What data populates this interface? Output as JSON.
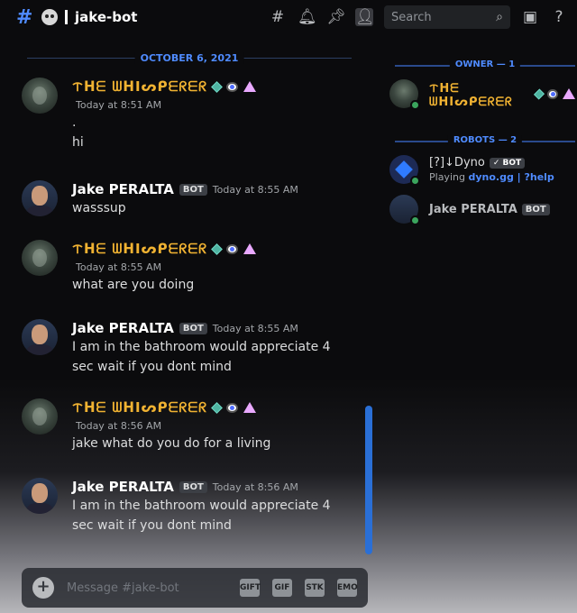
{
  "header": {
    "channel_name": "jake-bot",
    "search_placeholder": "Search"
  },
  "date_separator": "OCTOBER 6, 2021",
  "messages": [
    {
      "author": "ᝨᕼᗴ ᗯᕼIᔕᑭᗴᖇᗴᖇ",
      "timestamp": "Today at 8:51 AM",
      "lines": [
        ".",
        "hi"
      ]
    },
    {
      "author": "Jake PERALTA",
      "bot_tag": "BOT",
      "timestamp": "Today at 8:55 AM",
      "lines": [
        "wasssup"
      ]
    },
    {
      "author": "ᝨᕼᗴ ᗯᕼIᔕᑭᗴᖇᗴᖇ",
      "timestamp": "Today at 8:55 AM",
      "lines": [
        "what are you doing"
      ]
    },
    {
      "author": "Jake PERALTA",
      "bot_tag": "BOT",
      "timestamp": "Today at 8:55 AM",
      "lines": [
        "I am in the bathroom would appreciate 4",
        "sec wait if you dont mind"
      ]
    },
    {
      "author": "ᝨᕼᗴ ᗯᕼIᔕᑭᗴᖇᗴᖇ",
      "timestamp": "Today at 8:56 AM",
      "lines": [
        "jake what do you do for a living"
      ]
    },
    {
      "author": "Jake PERALTA",
      "bot_tag": "BOT",
      "timestamp": "Today at 8:56 AM",
      "lines": [
        "I am in the bathroom would appreciate 4",
        "sec wait if you dont mind"
      ]
    }
  ],
  "members": {
    "owner_header": "OWNER — 1",
    "robots_header": "ROBOTS — 2",
    "owner": {
      "name": "ᝨᕼᗴ ᗯᕼIᔕᑭᗴᖇᗴᖇ"
    },
    "robots": [
      {
        "name": "[?]↓Dyno",
        "tag": "✓ BOT",
        "activity_prefix": "Playing ",
        "activity_game": "dyno.gg | ?help"
      },
      {
        "name": "Jake PERALTA",
        "tag": "BOT"
      }
    ]
  },
  "composer": {
    "placeholder": "Message #jake-bot",
    "tools": [
      "GIFT",
      "GIF",
      "STK",
      "EMO"
    ]
  },
  "colors": {
    "accent": "#4f8bff",
    "gold_role": "#f0b232",
    "online": "#3ba55d"
  }
}
